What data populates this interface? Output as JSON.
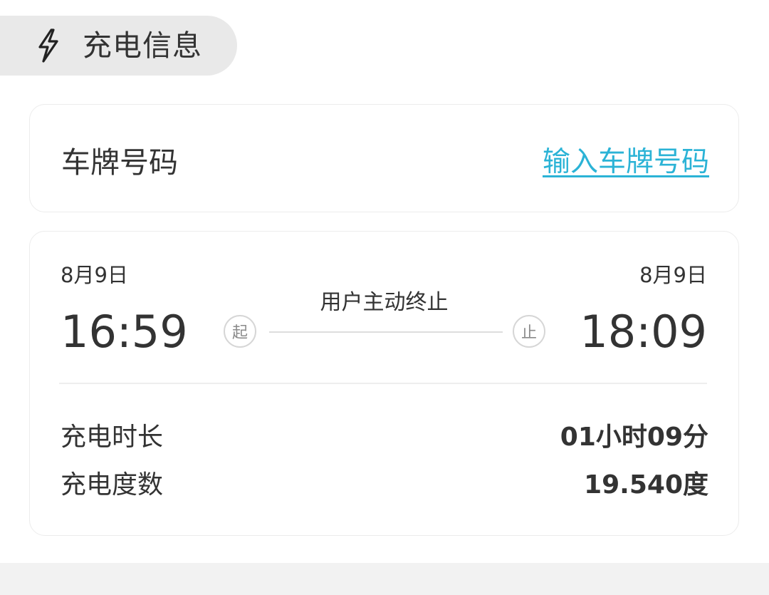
{
  "section": {
    "title": "充电信息",
    "icon": "lightning-bolt-icon"
  },
  "plate": {
    "label": "车牌号码",
    "link_text": "输入车牌号码",
    "link_color": "#2bb3d6"
  },
  "session": {
    "start": {
      "date": "8月9日",
      "time": "16:59",
      "marker": "起"
    },
    "end": {
      "date": "8月9日",
      "time": "18:09",
      "marker": "止"
    },
    "end_reason": "用户主动终止",
    "details": [
      {
        "label": "充电时长",
        "value": "01小时09分"
      },
      {
        "label": "充电度数",
        "value": "19.540度"
      }
    ]
  }
}
